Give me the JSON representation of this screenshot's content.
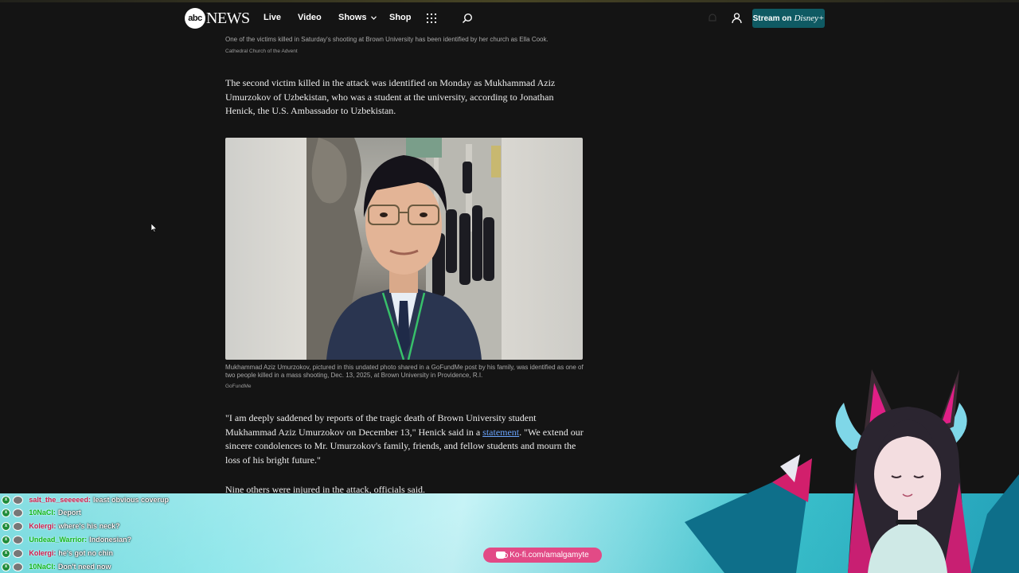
{
  "nav": {
    "logo_abc": "abc",
    "logo_news": "NEWS",
    "items": [
      "Live",
      "Video",
      "Shows",
      "Shop"
    ],
    "stream_label": "Stream on",
    "stream_brand": "Disney+"
  },
  "article": {
    "top_caption": "One of the victims killed in Saturday's shooting at Brown University has been identified by her church as Ella Cook.",
    "top_credit": "Cathedral Church of the Advent",
    "para1": "The second victim killed in the attack was identified on Monday as Mukhammad Aziz Umurzokov of Uzbekistan, who was a student at the university, according to Jonathan Henick, the U.S. Ambassador to Uzbekistan.",
    "photo_caption": "Mukhammad Aziz Umurzokov, pictured in this undated photo shared in a GoFundMe post by his family, was identified as one of two people killed in a mass shooting, Dec. 13, 2025, at Brown University in Providence, R.I.",
    "photo_credit": "GoFundMe",
    "para2_before": "\"I am deeply saddened by reports of the tragic death of Brown University student Mukhammad Aziz Umurzokov on December 13,\" Henick said in a ",
    "para2_link": "statement",
    "para2_after": ". \"We extend our sincere condolences to Mr. Umurzokov's family, friends, and fellow students and mourn the loss of his bright future.\"",
    "para3": "Nine others were injured in the attack, officials said."
  },
  "chat": [
    {
      "user": "salt_the_seeeeed:",
      "message": "least obvious coverup",
      "color": "#d11a4a"
    },
    {
      "user": "10NaCl:",
      "message": "Deport",
      "color": "#15b81b"
    },
    {
      "user": "Kolergi:",
      "message": "where's his neck?",
      "color": "#d11a4a"
    },
    {
      "user": "Undead_Warrior:",
      "message": "Indonesian?",
      "color": "#15b81b"
    },
    {
      "user": "Kolergi:",
      "message": "he's got no chin",
      "color": "#d11a4a"
    },
    {
      "user": "10NaCl:",
      "message": "Don't need now",
      "color": "#15b81b"
    }
  ],
  "kofi": {
    "label": "Ko-fi.com/amalgamyte"
  },
  "colors": {
    "background": "#141414",
    "stream_button": "#0f5a63",
    "link": "#6aa5ff",
    "kofi": "#e24a86",
    "overlay": "#8de6ea"
  }
}
